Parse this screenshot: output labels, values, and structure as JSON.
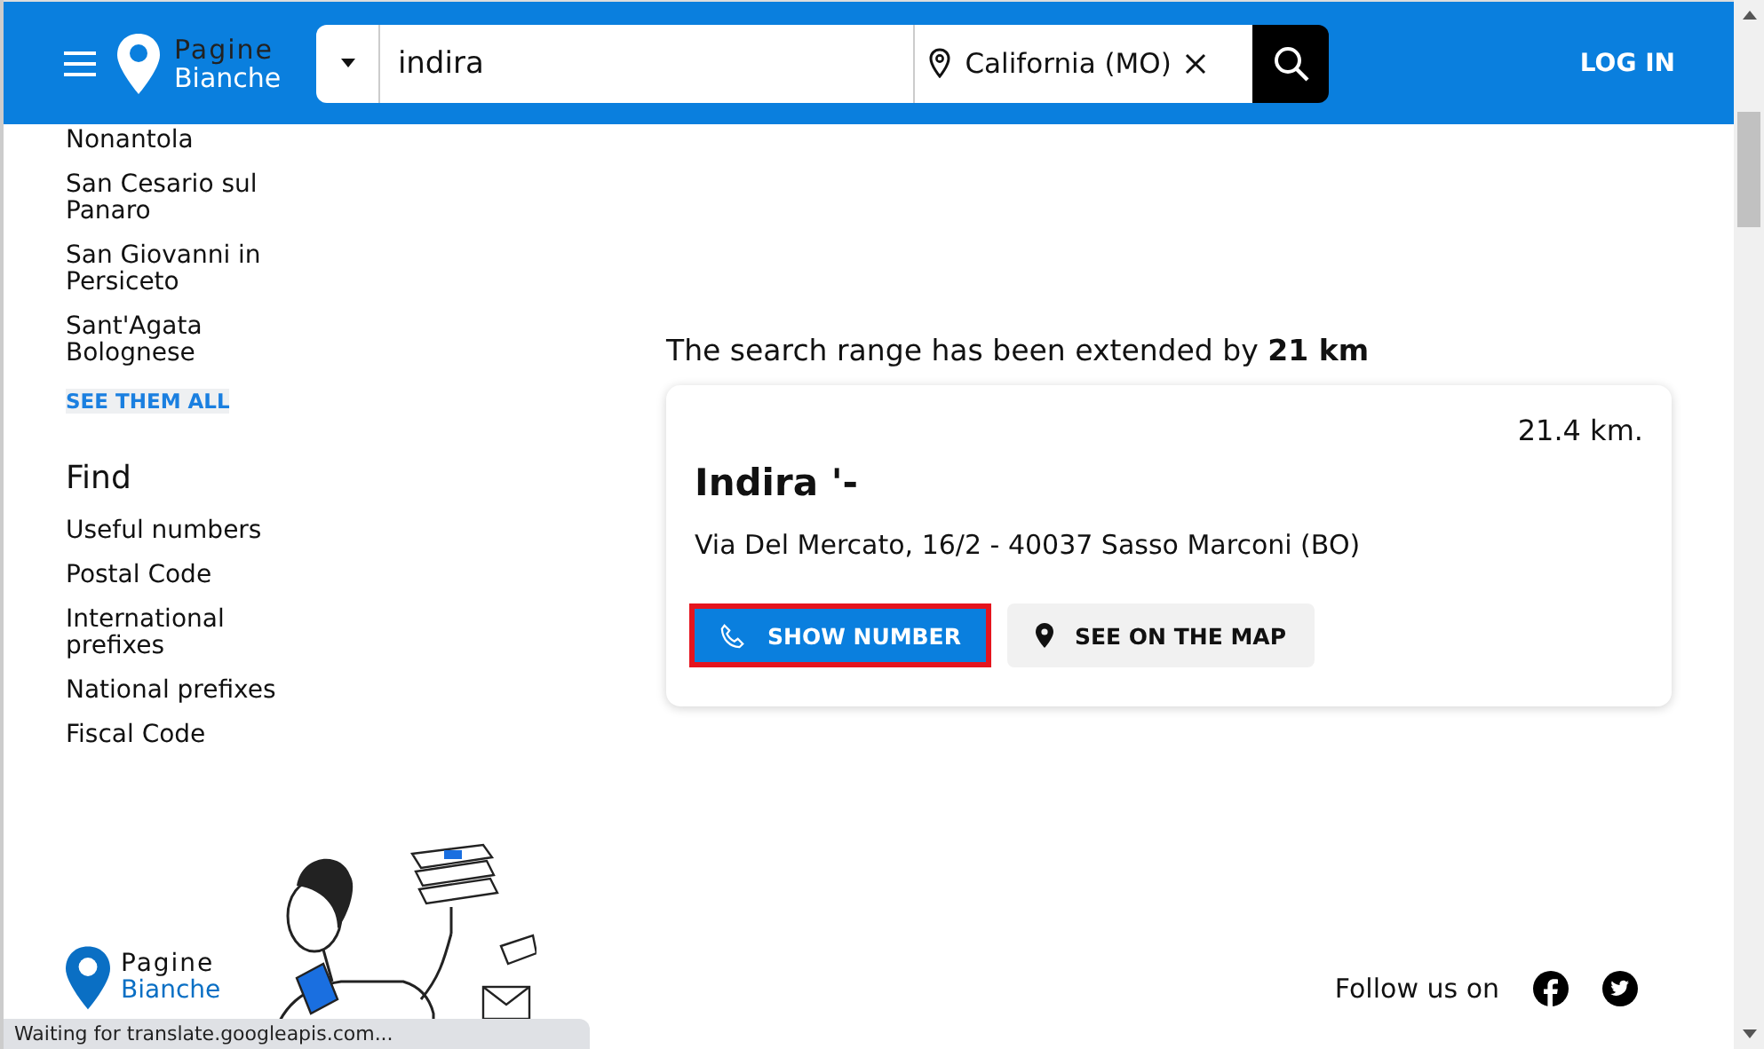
{
  "header": {
    "logo": {
      "line1": "Pagine",
      "line2": "Bianche"
    },
    "search": {
      "value": "indira",
      "location": "California (MO)"
    },
    "login": "LOG IN"
  },
  "sidebar": {
    "cities": [
      "Nonantola",
      "San Cesario sul Panaro",
      "San Giovanni in Persiceto",
      "Sant'Agata Bolognese"
    ],
    "see_all": "SEE THEM ALL",
    "find_title": "Find",
    "find_links": [
      "Useful numbers",
      "Postal Code",
      "International prefixes",
      "National prefixes",
      "Fiscal Code"
    ]
  },
  "results": {
    "notice": "The search range has been extended by **21 km**",
    "listing": {
      "distance": "21.4 km.",
      "name": "Indira '-",
      "address": "Via Del Mercato, 16/2 - 40037 Sasso Marconi (BO)",
      "buttons": [
        {
          "label": "SHOW NUMBER",
          "kind": "phone",
          "highlighted": true
        },
        {
          "label": "SEE ON THE MAP",
          "kind": "map",
          "highlighted": false
        }
      ]
    }
  },
  "footer": {
    "logo": {
      "line1": "Pagine",
      "line2": "Bianche"
    },
    "follow": "Follow us on"
  },
  "status_bar": "Waiting for translate.googleapis.com..."
}
